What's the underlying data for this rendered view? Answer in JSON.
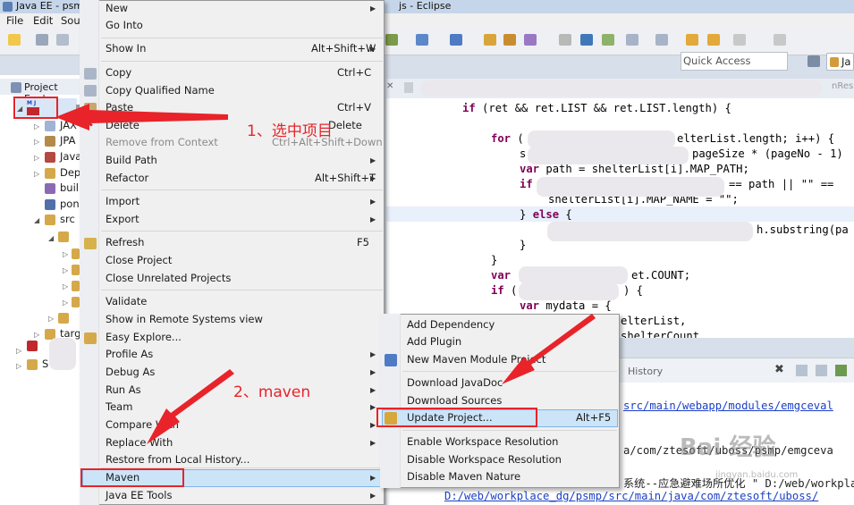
{
  "window": {
    "title_left": "Java EE - psm",
    "title_right": "js - Eclipse"
  },
  "menubar": {
    "file": "File",
    "edit": "Edit",
    "source": "Sou"
  },
  "quick_access": {
    "placeholder": "Quick Access"
  },
  "perspective": {
    "label": "Ja"
  },
  "project_explorer": {
    "title": "Project Explo",
    "items": [
      {
        "label": "JAX"
      },
      {
        "label": "JPA"
      },
      {
        "label": "Java"
      },
      {
        "label": "Dep"
      },
      {
        "label": "buil"
      },
      {
        "label": "pon"
      },
      {
        "label": "src"
      },
      {
        "label": "targ"
      },
      {
        "label": "S"
      }
    ]
  },
  "editor": {
    "tab_suffix": "nRes",
    "lines": [
      {
        "a": "if (ret && ret.LIST && ret.LIST.length) {"
      },
      {
        "a": "for (",
        "b": "elterList.length; i++) {"
      },
      {
        "a": "s",
        "b": "pageSize * (pageNo - 1)"
      },
      {
        "a": "var path = shelterList[i].MAP_PATH;"
      },
      {
        "a": "if",
        "b": "== path || \"\" =="
      },
      {
        "a": "shelterList[i].MAP_NAME = \"\";"
      },
      {
        "a": "} else {"
      },
      {
        "a": "h.substring(pa"
      },
      {
        "a": "}"
      },
      {
        "a": "}"
      },
      {
        "a": "var",
        "b": "et.COUNT;"
      },
      {
        "a": "if (",
        "b": ") {"
      },
      {
        "a": "var mydata = {"
      },
      {
        "a": "elterList,"
      },
      {
        "a": "shelterCount"
      }
    ]
  },
  "console": {
    "tab": "History",
    "lines": [
      {
        "text": "src/main/webapp/modules/emgceval"
      },
      {
        "text": "a/com/ztesoft/uboss/psmp/emgceva"
      },
      {
        "text": "系统--应急避难场所优化 \" D:/web/workplac"
      },
      {
        "text": "D:/web/workplace_dg/psmp/src/main/java/com/ztesoft/uboss/"
      }
    ]
  },
  "context_menu": {
    "items": [
      {
        "label": "New"
      },
      {
        "label": "Go Into"
      },
      {
        "label": "Show In",
        "shortcut": "Alt+Shift+W"
      },
      {
        "label": "Copy",
        "shortcut": "Ctrl+C"
      },
      {
        "label": "Copy Qualified Name"
      },
      {
        "label": "Paste",
        "shortcut": "Ctrl+V"
      },
      {
        "label": "Delete",
        "shortcut": "Delete"
      },
      {
        "label": "Remove from Context",
        "shortcut": "Ctrl+Alt+Shift+Down"
      },
      {
        "label": "Build Path"
      },
      {
        "label": "Refactor",
        "shortcut": "Alt+Shift+T"
      },
      {
        "label": "Import"
      },
      {
        "label": "Export"
      },
      {
        "label": "Refresh",
        "shortcut": "F5"
      },
      {
        "label": "Close Project"
      },
      {
        "label": "Close Unrelated Projects"
      },
      {
        "label": "Validate"
      },
      {
        "label": "Show in Remote Systems view"
      },
      {
        "label": "Easy Explore..."
      },
      {
        "label": "Profile As"
      },
      {
        "label": "Debug As"
      },
      {
        "label": "Run As"
      },
      {
        "label": "Team"
      },
      {
        "label": "Compare With"
      },
      {
        "label": "Replace With"
      },
      {
        "label": "Restore from Local History..."
      },
      {
        "label": "Maven"
      },
      {
        "label": "Java EE Tools"
      }
    ]
  },
  "maven_submenu": {
    "items": [
      {
        "label": "Add Dependency"
      },
      {
        "label": "Add Plugin"
      },
      {
        "label": "New Maven Module Project"
      },
      {
        "label": "Download JavaDoc"
      },
      {
        "label": "Download Sources"
      },
      {
        "label": "Update Project...",
        "shortcut": "Alt+F5"
      },
      {
        "label": "Enable Workspace Resolution"
      },
      {
        "label": "Disable Workspace Resolution"
      },
      {
        "label": "Disable Maven Nature"
      }
    ]
  },
  "annotations": {
    "step1": "1、选中项目",
    "step2": "2、maven"
  },
  "watermark": {
    "main": "Bai 经验",
    "sub": "jingyan.baidu.com"
  },
  "colors": {
    "annotation_red": "#e8232a",
    "keyword": "#7f0055",
    "link": "#1a3fc6",
    "menu_bg": "#f0f0f0",
    "highlight": "#cce4f7"
  }
}
